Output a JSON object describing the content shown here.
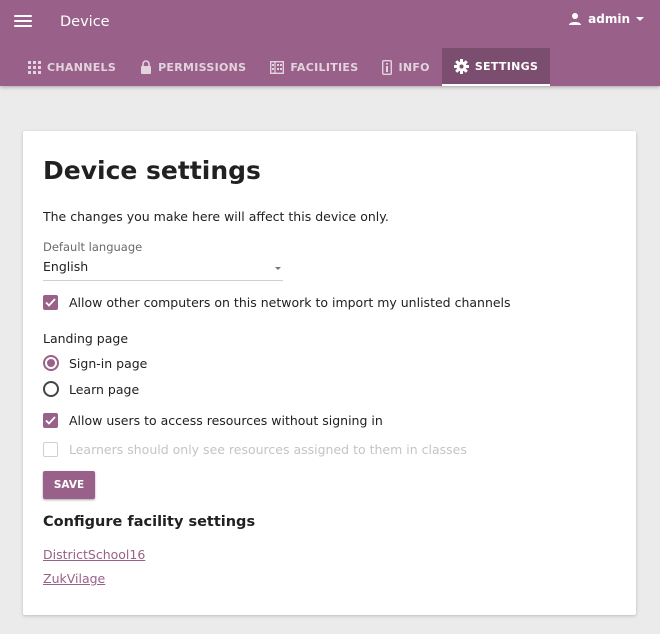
{
  "header": {
    "title": "Device",
    "user": "admin",
    "colors": {
      "brand": "#996189",
      "tab_active": "#7b4d6e"
    }
  },
  "tabs": [
    {
      "label": "CHANNELS",
      "icon": "grid-icon",
      "active": false
    },
    {
      "label": "PERMISSIONS",
      "icon": "lock-icon",
      "active": false
    },
    {
      "label": "FACILITIES",
      "icon": "building-icon",
      "active": false
    },
    {
      "label": "INFO",
      "icon": "info-icon",
      "active": false
    },
    {
      "label": "SETTINGS",
      "icon": "gear-icon",
      "active": true
    }
  ],
  "settings": {
    "title": "Device settings",
    "description": "The changes you make here will affect this device only.",
    "language_label": "Default language",
    "language_value": "English",
    "allow_import_label": "Allow other computers on this network to import my unlisted channels",
    "allow_import_checked": true,
    "landing_page_label": "Landing page",
    "landing_options": [
      {
        "label": "Sign-in page",
        "selected": true
      },
      {
        "label": "Learn page",
        "selected": false
      }
    ],
    "allow_guest_label": "Allow users to access resources without signing in",
    "allow_guest_checked": true,
    "learners_assigned_label": "Learners should only see resources assigned to them in classes",
    "learners_assigned_checked": false,
    "learners_assigned_disabled": true,
    "save_label": "SAVE"
  },
  "facilities": {
    "title": "Configure facility settings",
    "links": [
      "DistrictSchool16",
      "ZukVilage"
    ]
  }
}
